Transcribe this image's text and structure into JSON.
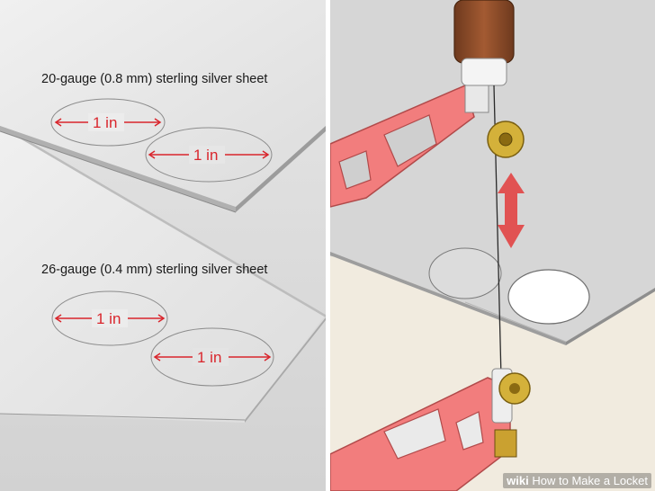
{
  "top_sheet": {
    "label": "20-gauge (0.8 mm) sterling silver sheet",
    "circle_labels": [
      "1 in",
      "1 in"
    ]
  },
  "bottom_sheet": {
    "label": "26-gauge (0.4 mm) sterling silver sheet",
    "circle_labels": [
      "1 in",
      "1 in"
    ]
  },
  "watermark": {
    "brand": "wiki",
    "title": "How to Make a Locket"
  },
  "colors": {
    "dimension_red": "#d9252c",
    "saw_frame": "#f27d7d",
    "handle_wood": "#8a4a2a",
    "brass": "#d4b13a"
  }
}
